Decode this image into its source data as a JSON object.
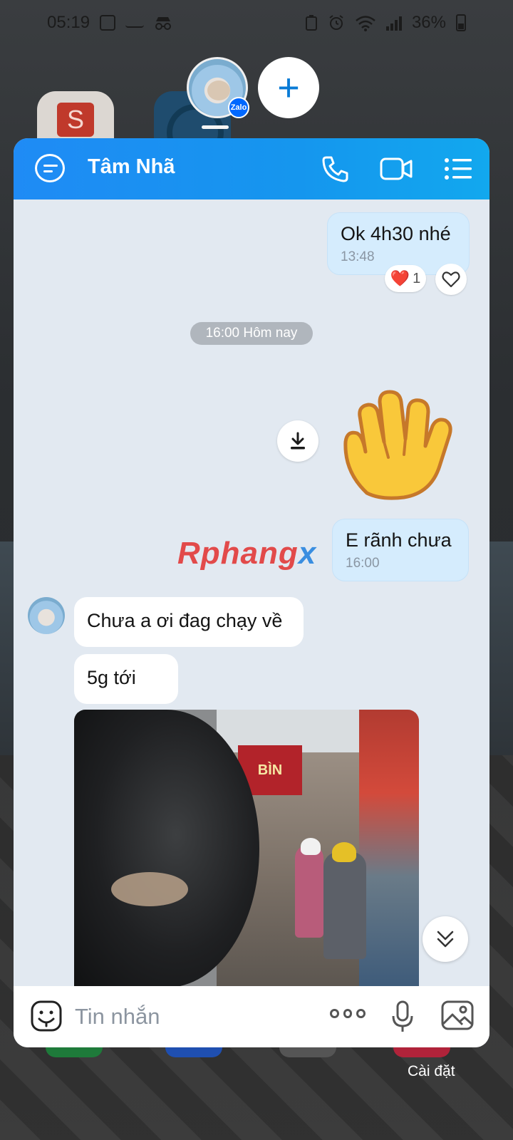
{
  "status_bar": {
    "time": "05:19",
    "battery": "36%"
  },
  "background_apps": {
    "shopee_letter": "S"
  },
  "bubble_heads": {
    "active_badge": "Zalo",
    "add_label": "+"
  },
  "chat": {
    "contact_name": "Tâm Nhã",
    "messages": [
      {
        "text": "Ok 4h30 nhé",
        "time": "13:48",
        "sender": "me"
      },
      {
        "text": "E rãnh chưa",
        "time": "16:00",
        "sender": "me"
      },
      {
        "text": "Chưa a ơi đag chạy về",
        "sender": "them"
      },
      {
        "text": "5g tới",
        "sender": "them"
      }
    ],
    "reaction": {
      "emoji": "❤️",
      "count": "1"
    },
    "date_separator": "16:00 Hôm nay",
    "photo_sign_text": "BÌN"
  },
  "watermark": {
    "part_a": "Rphang",
    "part_b": "x"
  },
  "input": {
    "placeholder": "Tin nhắn"
  },
  "settings_label": "Cài đặt",
  "colors": {
    "header_start": "#1f8bf5",
    "header_end": "#12a8ee",
    "my_bubble": "#d5ecfd",
    "chat_background": "#e2e9f1"
  }
}
